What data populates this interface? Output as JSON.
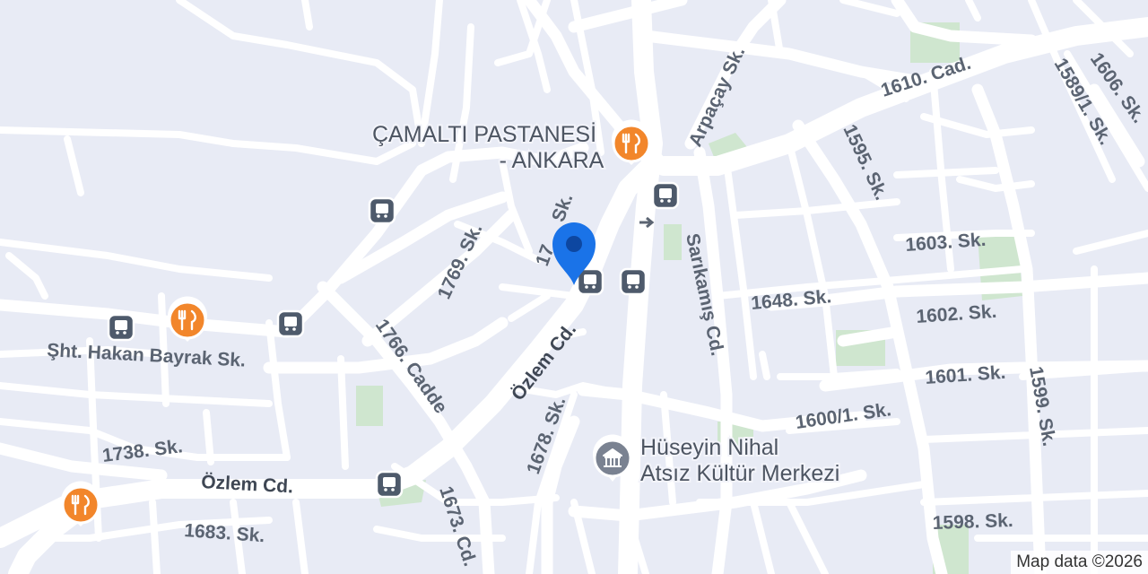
{
  "map": {
    "colors": {
      "background": "#e8ebf5",
      "road": "#ffffff",
      "park": "#cfe6cf",
      "label": "#5b6472",
      "restaurant": "#f2862b",
      "transit": "#4e5a6b",
      "location": "#1a73e8"
    },
    "streets": [
      "1610. Cad.",
      "Arpaçay Sk.",
      "1595. Sk.",
      "1606. Sk.",
      "1589/1. Sk.",
      "1603. Sk.",
      "1769. Sk.",
      "17__ Sk.",
      "Sarıkamış Cd.",
      "1648. Sk.",
      "1602. Sk.",
      "Özlem Cd.",
      "1766. Cadde",
      "Şht. Hakan Bayrak Sk.",
      "1601. Sk.",
      "1599. Sk.",
      "1600/1. Sk.",
      "1678. Sk.",
      "1738. Sk.",
      "Özlem Cd.",
      "1673. Cd.",
      "1683. Sk.",
      "1598. Sk."
    ],
    "pois": {
      "pastane_line1": "ÇAMALTI PASTANESİ",
      "pastane_line2": "- ANKARA",
      "kultur_line1": "Hüseyin Nihal",
      "kultur_line2": "Atsız Kültür Merkezi"
    },
    "icons": [
      "restaurant-icon",
      "bus-stop-icon",
      "museum-icon",
      "location-pin-icon",
      "one-way-arrow-icon"
    ],
    "attribution": "Map data ©2026"
  }
}
